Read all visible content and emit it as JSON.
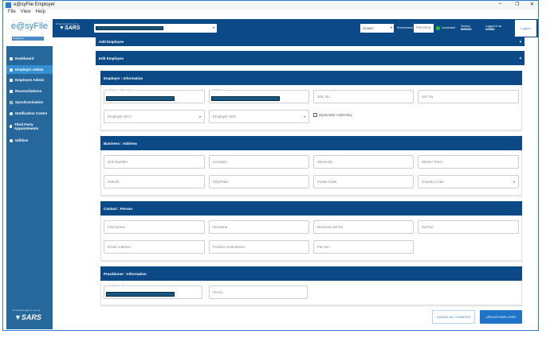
{
  "window": {
    "title": "e@syFile Employer",
    "minimize": "–",
    "restore": "❐",
    "close": "✕"
  },
  "menu": [
    "File",
    "View",
    "Help"
  ],
  "logo": {
    "text": "e@syFile",
    "badge": "Employer"
  },
  "header": {
    "sars": "SARS",
    "tagline": "Proudly brought to you by",
    "year": "201802",
    "environment_label": "Environment",
    "environment": "PRE-PROD",
    "status": "Connected",
    "status_color": "#22c322",
    "version_label": "Version",
    "version": "8050520",
    "logged_label": "Logged in as",
    "user": "ADMIN",
    "logout": "Logout"
  },
  "sidebar": [
    {
      "label": "Dashboard"
    },
    {
      "label": "Employer Admin",
      "active": true
    },
    {
      "label": "Employee Admin"
    },
    {
      "label": "Reconciliations"
    },
    {
      "label": "Synchronisation"
    },
    {
      "label": "Notification Centre"
    },
    {
      "label": "Third Party Appointments"
    },
    {
      "label": "Utilities"
    }
  ],
  "sidebar_footer": {
    "tagline": "Proudly brought to you by",
    "sars": "SARS"
  },
  "panels": {
    "add": "Add Employee",
    "edit": "Edit Employee"
  },
  "employer": {
    "title": "Employer : Information",
    "trading_label": "Trading or Other name",
    "paye_label": "PAYE No",
    "sdl": "SDL No",
    "uif": "UIF No",
    "sic7": "Employer SIC7",
    "sez": "Employer SEZ",
    "diplomatic": "Diplomatic Indemnity"
  },
  "address": {
    "title": "Business : Address",
    "fields": [
      "Unit Number",
      "Complex",
      "Street No",
      "Street / Farm",
      "Suburb",
      "City/Town",
      "Postal Code",
      "Country Code"
    ]
  },
  "contact": {
    "title": "Contact : Person",
    "fields": [
      "First Name",
      "Surname",
      "Business Tel No",
      "Cell No",
      "Email Address",
      "Position at Business",
      "Fax No"
    ]
  },
  "practitioner": {
    "title": "Practitioner : Information",
    "reg_label": "Registration No",
    "tel": "Tel No"
  },
  "actions": {
    "cancel": "CANCEL ALL CHANGES",
    "update": "UPDATE EMPLOYER"
  }
}
